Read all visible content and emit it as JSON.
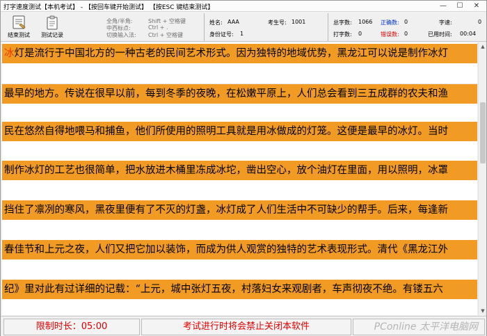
{
  "window": {
    "title": "打字速度测试【本机考试】 - 【按回车键开始测试】 【按ESC 键结束测试】",
    "min_glyph": "—",
    "max_glyph": "☐",
    "close_glyph": "✕"
  },
  "toolbar": {
    "end_test_label": "结束测试",
    "record_label": "测试记录",
    "shortcuts": [
      {
        "name": "全角/半角:",
        "keys": "Shift + 空格键"
      },
      {
        "name": "中西标点:",
        "keys": "Ctrl + ."
      },
      {
        "name": "切换输入法:",
        "keys": "Ctrl + 空格键"
      }
    ]
  },
  "candidate": {
    "name_label": "姓名:",
    "name_value": "AAA",
    "exam_no_label": "考生号:",
    "exam_no_value": "1001",
    "id_label": "身份证号:",
    "id_value": "1"
  },
  "stats": {
    "total_label": "总字数:",
    "total_value": "1066",
    "correct_label": "正确数:",
    "correct_value": "0",
    "speed_label": "字速:",
    "speed_value": "0",
    "typed_label": "打字数:",
    "typed_value": "0",
    "wrong_label": "错误数:",
    "wrong_value": "0",
    "elapsed_label": "已用时间:",
    "elapsed_value": "00:04"
  },
  "colors": {
    "accent_row": "#f19a24",
    "status_red": "#e00000",
    "correct_blue": "#0033cc"
  },
  "lines": [
    {
      "first": "冰",
      "rest": "灯是流行于中国北方的一种古老的民间艺术形式。因为独特的地域优势，黑龙江可以说是制作冰灯"
    },
    {
      "first": "",
      "rest": "最早的地方。传说在很早以前，每到冬季的夜晚，在松嫩平原上，人们总会看到三五成群的农夫和渔"
    },
    {
      "first": "",
      "rest": "民在悠然自得地喂马和捕鱼，他们所使用的照明工具就是用冰做成的灯笼。这便是最早的冰灯。当时"
    },
    {
      "first": "",
      "rest": "制作冰灯的工艺也很简单，把水放进木桶里冻成冰坨，凿出空心，放个油灯在里面，用以照明，冰罩"
    },
    {
      "first": "",
      "rest": "挡住了凛冽的寒风，黑夜里便有了不灭的灯盏，冰灯成了人们生活中不可缺少的帮手。后来，每逢新"
    },
    {
      "first": "",
      "rest": "春佳节和上元之夜，人们又把它加以装饰，而成为供人观赏的独特的艺术表现形式。清代《黑龙江外"
    },
    {
      "first": "",
      "rest": "纪》里对此有过详细的记载：“上元，城中张灯五夜，村落妇女来观剧者，车声彻夜不绝。有镂五六"
    }
  ],
  "status": {
    "time_limit": "限制时长：05:00",
    "notice": "考试进行时将会禁止关闭本软件"
  },
  "watermark": "PConline 太平洋电脑网"
}
